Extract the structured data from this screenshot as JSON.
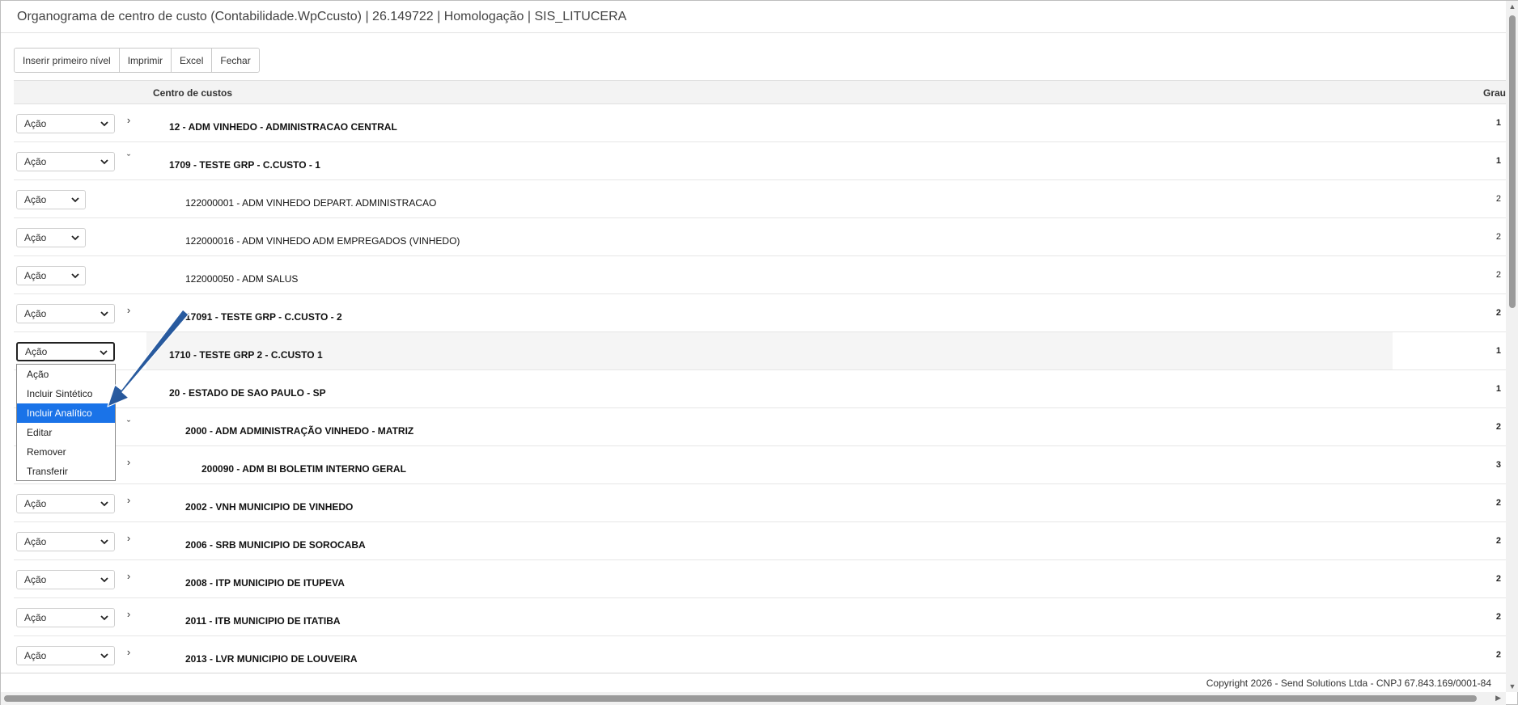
{
  "window": {
    "title": "Organograma de centro de custo (Contabilidade.WpCcusto) | 26.149722 | Homologação | SIS_LITUCERA"
  },
  "toolbar": {
    "insert_first_level": "Inserir primeiro nível",
    "print": "Imprimir",
    "excel": "Excel",
    "close": "Fechar"
  },
  "grid": {
    "col_center": "Centro de custos",
    "col_grau": "Grau",
    "action_label": "Ação",
    "rows": [
      {
        "label": "12 - ADM VINHEDO - ADMINISTRACAO CENTRAL",
        "grau": "1",
        "expander": "›"
      },
      {
        "label": "1709 - TESTE GRP - C.CUSTO - 1",
        "grau": "1",
        "expander": "ˇ"
      },
      {
        "label": "122000001 - ADM VINHEDO DEPART. ADMINISTRACAO",
        "grau": "2",
        "expander": ""
      },
      {
        "label": "122000016 - ADM VINHEDO ADM EMPREGADOS (VINHEDO)",
        "grau": "2",
        "expander": ""
      },
      {
        "label": "122000050 - ADM SALUS",
        "grau": "2",
        "expander": ""
      },
      {
        "label": "17091 - TESTE GRP - C.CUSTO - 2",
        "grau": "2",
        "expander": "›"
      },
      {
        "label": "1710 - TESTE GRP 2 - C.CUSTO 1",
        "grau": "1",
        "expander": ""
      },
      {
        "label": "20 - ESTADO DE SAO PAULO - SP",
        "grau": "1",
        "expander": ""
      },
      {
        "label": "2000 - ADM ADMINISTRAÇÃO VINHEDO - MATRIZ",
        "grau": "2",
        "expander": "ˇ"
      },
      {
        "label": "200090 - ADM BI BOLETIM INTERNO GERAL",
        "grau": "3",
        "expander": "›"
      },
      {
        "label": "2002 - VNH MUNICIPIO DE VINHEDO",
        "grau": "2",
        "expander": "›"
      },
      {
        "label": "2006 - SRB MUNICIPIO DE SOROCABA",
        "grau": "2",
        "expander": "›"
      },
      {
        "label": "2008 - ITP MUNICIPIO DE ITUPEVA",
        "grau": "2",
        "expander": "›"
      },
      {
        "label": "2011 - ITB MUNICIPIO DE ITATIBA",
        "grau": "2",
        "expander": "›"
      },
      {
        "label": "2013 - LVR MUNICIPIO DE LOUVEIRA",
        "grau": "2",
        "expander": "›"
      }
    ]
  },
  "dropdown": {
    "options": [
      "Ação",
      "Incluir Sintético",
      "Incluir Analítico",
      "Editar",
      "Remover",
      "Transferir"
    ],
    "highlighted": "Incluir Analítico"
  },
  "footer": {
    "copyright": "Copyright 2026 - Send Solutions Ltda - CNPJ 67.843.169/0001-84"
  },
  "colors": {
    "highlight": "#1a73e8",
    "annotation_arrow": "#1f4f8f"
  }
}
